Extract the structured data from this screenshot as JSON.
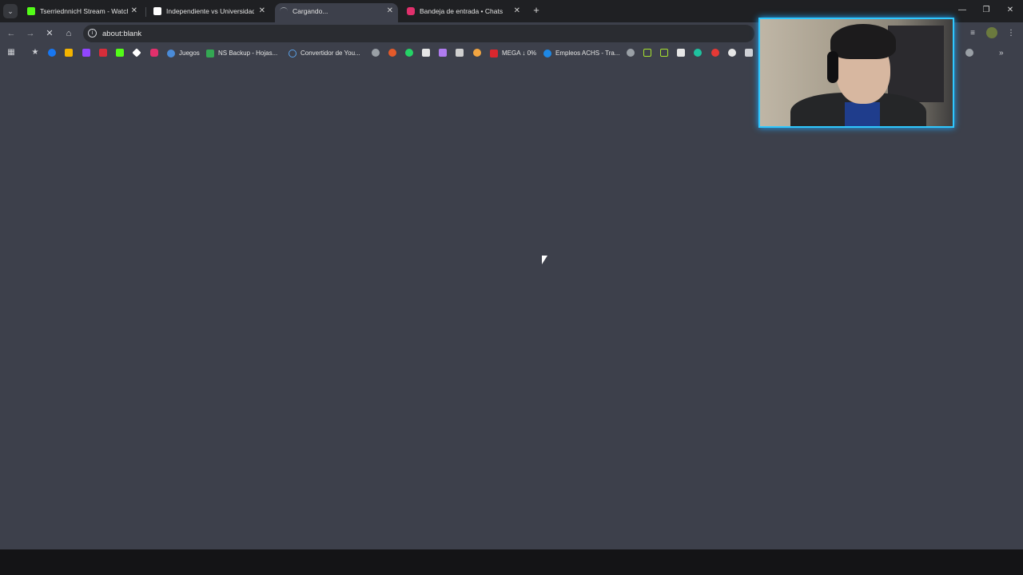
{
  "tabs": [
    {
      "title": "TserriednnicH Stream - Watch Liv",
      "favicon_color": "#53fc18"
    },
    {
      "title": "Independiente vs Universidad de",
      "favicon_color": "#ffffff"
    },
    {
      "title": "Cargando...",
      "favicon_color": "#9aa0a6",
      "active": true
    },
    {
      "title": "Bandeja de entrada • Chats",
      "favicon_color": "#e1306c"
    }
  ],
  "address": {
    "url": "about:blank"
  },
  "bookmarks": [
    {
      "label": "Juegos",
      "color": "#4a8bd8"
    },
    {
      "label": "NS Backup - Hojas...",
      "color": "#34a853"
    },
    {
      "label": "Convertidor de You...",
      "color": "#5aa0e6"
    },
    {
      "label": "MEGA ↓ 0%",
      "color": "#d9272e"
    },
    {
      "label": "Empleos ACHS - Tra...",
      "color": "#1e88e5"
    }
  ],
  "icons": {
    "tab_close": "✕",
    "new_tab": "+",
    "back": "←",
    "forward": "→",
    "stop": "✕",
    "home": "⌂",
    "minimize": "—",
    "restore": "❐",
    "window_close": "✕",
    "apps": "▦",
    "star": "★",
    "more": "»",
    "tab_search": "⌄"
  }
}
